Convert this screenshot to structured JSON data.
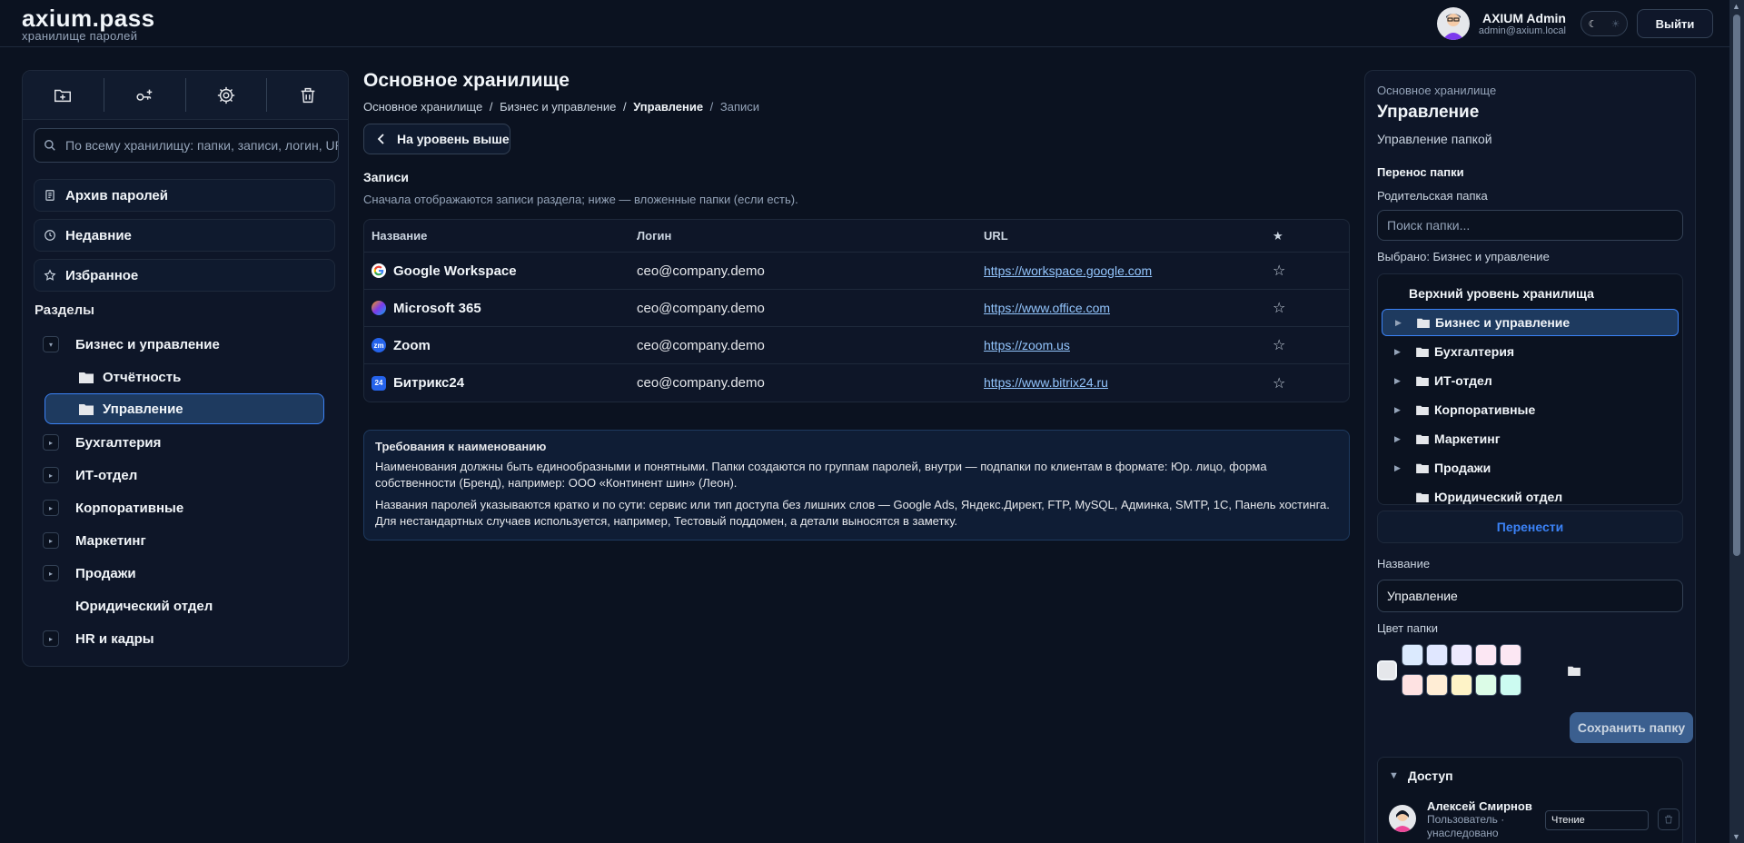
{
  "header": {
    "brand_title": "axium.pass",
    "brand_sub": "хранилище паролей",
    "user_name": "AXIUM Admin",
    "user_email": "admin@axium.local",
    "theme_dark_icon": "☾",
    "theme_light_icon": "☀",
    "logout_label": "Выйти"
  },
  "sidebar": {
    "tools": [
      {
        "icon": "folder-add-icon"
      },
      {
        "icon": "key-add-icon"
      },
      {
        "icon": "gear-icon"
      },
      {
        "icon": "trash-icon"
      }
    ],
    "search_placeholder": "По всему хранилищу: папки, записи, логин, URL",
    "quick": [
      {
        "label": "Архив паролей",
        "icon": "archive-icon"
      },
      {
        "label": "Недавние",
        "icon": "clock-icon"
      },
      {
        "label": "Избранное",
        "icon": "star-icon"
      }
    ],
    "sections_title": "Разделы",
    "tree": [
      {
        "label": "Бизнес и управление"
      },
      {
        "label": "Отчётность"
      },
      {
        "label": "Управление"
      },
      {
        "label": "Бухгалтерия"
      },
      {
        "label": "ИТ-отдел"
      },
      {
        "label": "Корпоративные"
      },
      {
        "label": "Маркетинг"
      },
      {
        "label": "Продажи"
      },
      {
        "label": "Юридический отдел"
      },
      {
        "label": "HR и кадры"
      }
    ]
  },
  "main": {
    "title": "Основное хранилище",
    "breadcrumb": [
      "Основное хранилище",
      "Бизнес и управление",
      "Управление",
      "Записи"
    ],
    "breadcrumb_sep": "/",
    "up_button": "На уровень выше",
    "records_title": "Записи",
    "records_desc": "Сначала отображаются записи раздела; ниже — вложенные папки (если есть).",
    "columns": [
      "Название",
      "Логин",
      "URL",
      "★"
    ],
    "rows": [
      {
        "name": "Google Workspace",
        "login": "ceo@company.demo",
        "url": "https://workspace.google.com",
        "badge": "G",
        "badge_color": "#ffffff"
      },
      {
        "name": "Microsoft 365",
        "login": "ceo@company.demo",
        "url": "https://www.office.com",
        "badge": "",
        "badge_color": "#7c3aed"
      },
      {
        "name": "Zoom",
        "login": "ceo@company.demo",
        "url": "https://zoom.us",
        "badge": "zm",
        "badge_color": "#2563eb"
      },
      {
        "name": "Битрикс24",
        "login": "ceo@company.demo",
        "url": "https://www.bitrix24.ru",
        "badge": "24",
        "badge_color": "#2563eb"
      }
    ],
    "star_icon": "☆",
    "info_title": "Требования к наименованию",
    "info_p1": "Наименования должны быть единообразными и понятными. Папки создаются по группам паролей, внутри — подпапки по клиентам в формате: Юр. лицо, форма собственности (Бренд), например: ООО «Континент шин» (Леон).",
    "info_p2": "Названия паролей указываются кратко и по сути: сервис или тип доступа без лишних слов — Google Ads, Яндекс.Директ, FTP, MySQL, Админка, SMTP, 1С, Панель хостинга. Для нестандартных случаев используется, например, Тестовый поддомен, а детали выносятся в заметку."
  },
  "right": {
    "crumb": "Основное хранилище",
    "title": "Управление",
    "subtitle": "Управление папкой",
    "move_title": "Перенос папки",
    "parent_label": "Родительская папка",
    "parent_search_placeholder": "Поиск папки...",
    "selected_text": "Выбрано: Бизнес и управление",
    "folders": [
      {
        "label": "Верхний уровень хранилища"
      },
      {
        "label": "Бизнес и управление"
      },
      {
        "label": "Бухгалтерия"
      },
      {
        "label": "ИТ-отдел"
      },
      {
        "label": "Корпоративные"
      },
      {
        "label": "Маркетинг"
      },
      {
        "label": "Продажи"
      },
      {
        "label": "Юридический отдел"
      }
    ],
    "move_button": "Перенести",
    "name_label": "Название",
    "name_value": "Управление",
    "color_label": "Цвет папки",
    "swatches_row1": [
      "#dbeafe",
      "#e0e7ff",
      "#ede9fe",
      "#fce7f3",
      "#fce7f3"
    ],
    "swatches_row2": [
      "#fee2e2",
      "#ffedd5",
      "#fef3c7",
      "#dcfce7",
      "#ccfbf1"
    ],
    "swatch_default": "#e5e7eb",
    "save_button": "Сохранить папку",
    "access_title": "Доступ",
    "member_name": "Алексей Смирнов",
    "member_role": "Пользователь · унаследовано",
    "member_perm": "Чтение"
  }
}
